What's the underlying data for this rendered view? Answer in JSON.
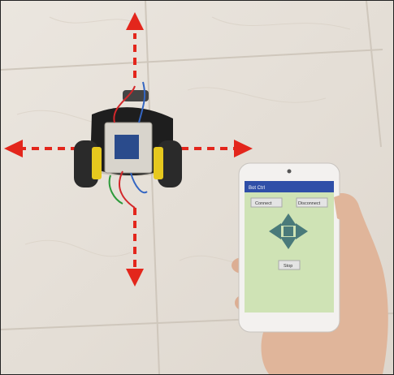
{
  "scene": {
    "description_icons": [
      "robot-car",
      "smartphone",
      "hand",
      "direction-arrows"
    ],
    "colors": {
      "floor": "#e6e0d8",
      "arrow": "#e3261c",
      "phone_body": "#f3f1ef",
      "app_bg": "#cfe3b5",
      "app_header": "#2f4fa8",
      "dpad": "#4a7a7a"
    }
  },
  "phone_app": {
    "title": "Bot Ctrl",
    "buttons": [
      "Connect",
      "Disconnect"
    ],
    "stop_label": "Stop"
  }
}
